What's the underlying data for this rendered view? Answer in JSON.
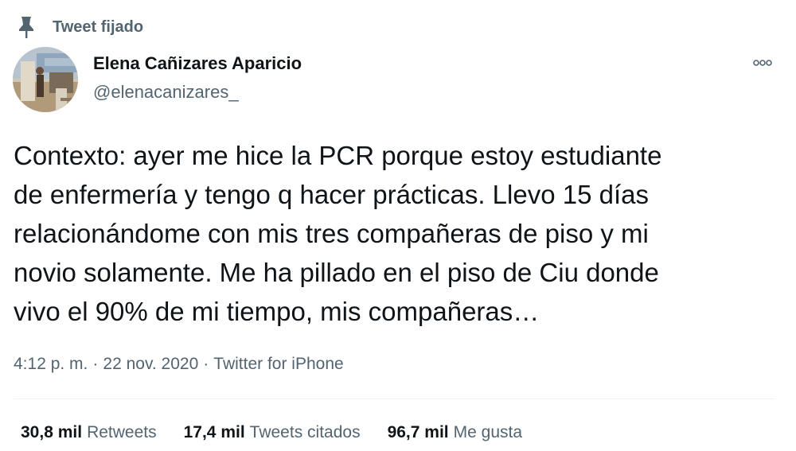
{
  "pinned": {
    "label": "Tweet fijado",
    "icon": "pin-icon"
  },
  "author": {
    "name": "Elena Cañizares Aparicio",
    "handle": "@elenacanizares_",
    "avatar_icon": "profile-photo"
  },
  "menu": {
    "icon": "more-options-icon"
  },
  "tweet": {
    "text": "Contexto: ayer me hice la PCR porque estoy estudiante\nde enfermería y tengo q hacer prácticas. Llevo 15 días\nrelacionándome con mis tres compañeras de piso y mi\nnovio solamente. Me ha pillado en el piso de Ciu donde\nvivo el 90% de mi tiempo, mis compañeras…"
  },
  "meta": {
    "time": "4:12 p. m.",
    "date": "22 nov. 2020",
    "source": "Twitter for iPhone",
    "separator": "·"
  },
  "stats": {
    "retweets_count": "30,8 mil",
    "retweets_label": "Retweets",
    "quotes_count": "17,4 mil",
    "quotes_label": "Tweets citados",
    "likes_count": "96,7 mil",
    "likes_label": "Me gusta"
  },
  "colors": {
    "primary_text": "#0f1419",
    "secondary_text": "#536471",
    "divider": "#eff3f4"
  }
}
